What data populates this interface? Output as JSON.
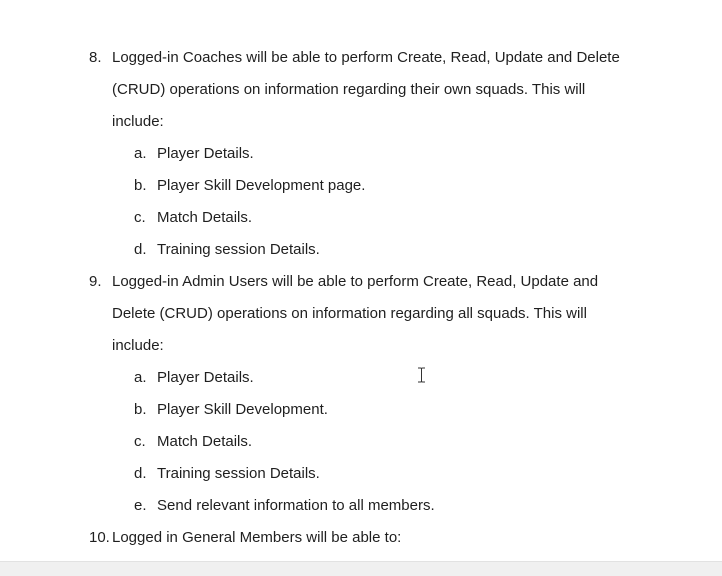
{
  "document": {
    "items": [
      {
        "number": "8.",
        "lines": [
          "Logged-in Coaches will be able to perform Create, Read, Update and Delete",
          "(CRUD) operations on information regarding their own squads. This will",
          "include:"
        ],
        "subitems": [
          {
            "letter": "a.",
            "text": "Player Details."
          },
          {
            "letter": "b.",
            "text": "Player Skill Development page."
          },
          {
            "letter": "c.",
            "text": "Match Details."
          },
          {
            "letter": "d.",
            "text": "Training session Details."
          }
        ]
      },
      {
        "number": "9.",
        "lines": [
          "Logged-in Admin Users will be able to perform Create, Read, Update and",
          "Delete (CRUD) operations on information regarding all squads. This will",
          "include:"
        ],
        "subitems": [
          {
            "letter": "a.",
            "text": "Player Details."
          },
          {
            "letter": "b.",
            "text": "Player Skill Development."
          },
          {
            "letter": "c.",
            "text": "Match Details."
          },
          {
            "letter": "d.",
            "text": "Training session Details."
          },
          {
            "letter": "e.",
            "text": "Send relevant information to all members."
          }
        ]
      },
      {
        "number": "10.",
        "lines": [
          "Logged in General Members will be able to:"
        ]
      }
    ]
  },
  "cursor": {
    "icon": "text-cursor-icon"
  }
}
